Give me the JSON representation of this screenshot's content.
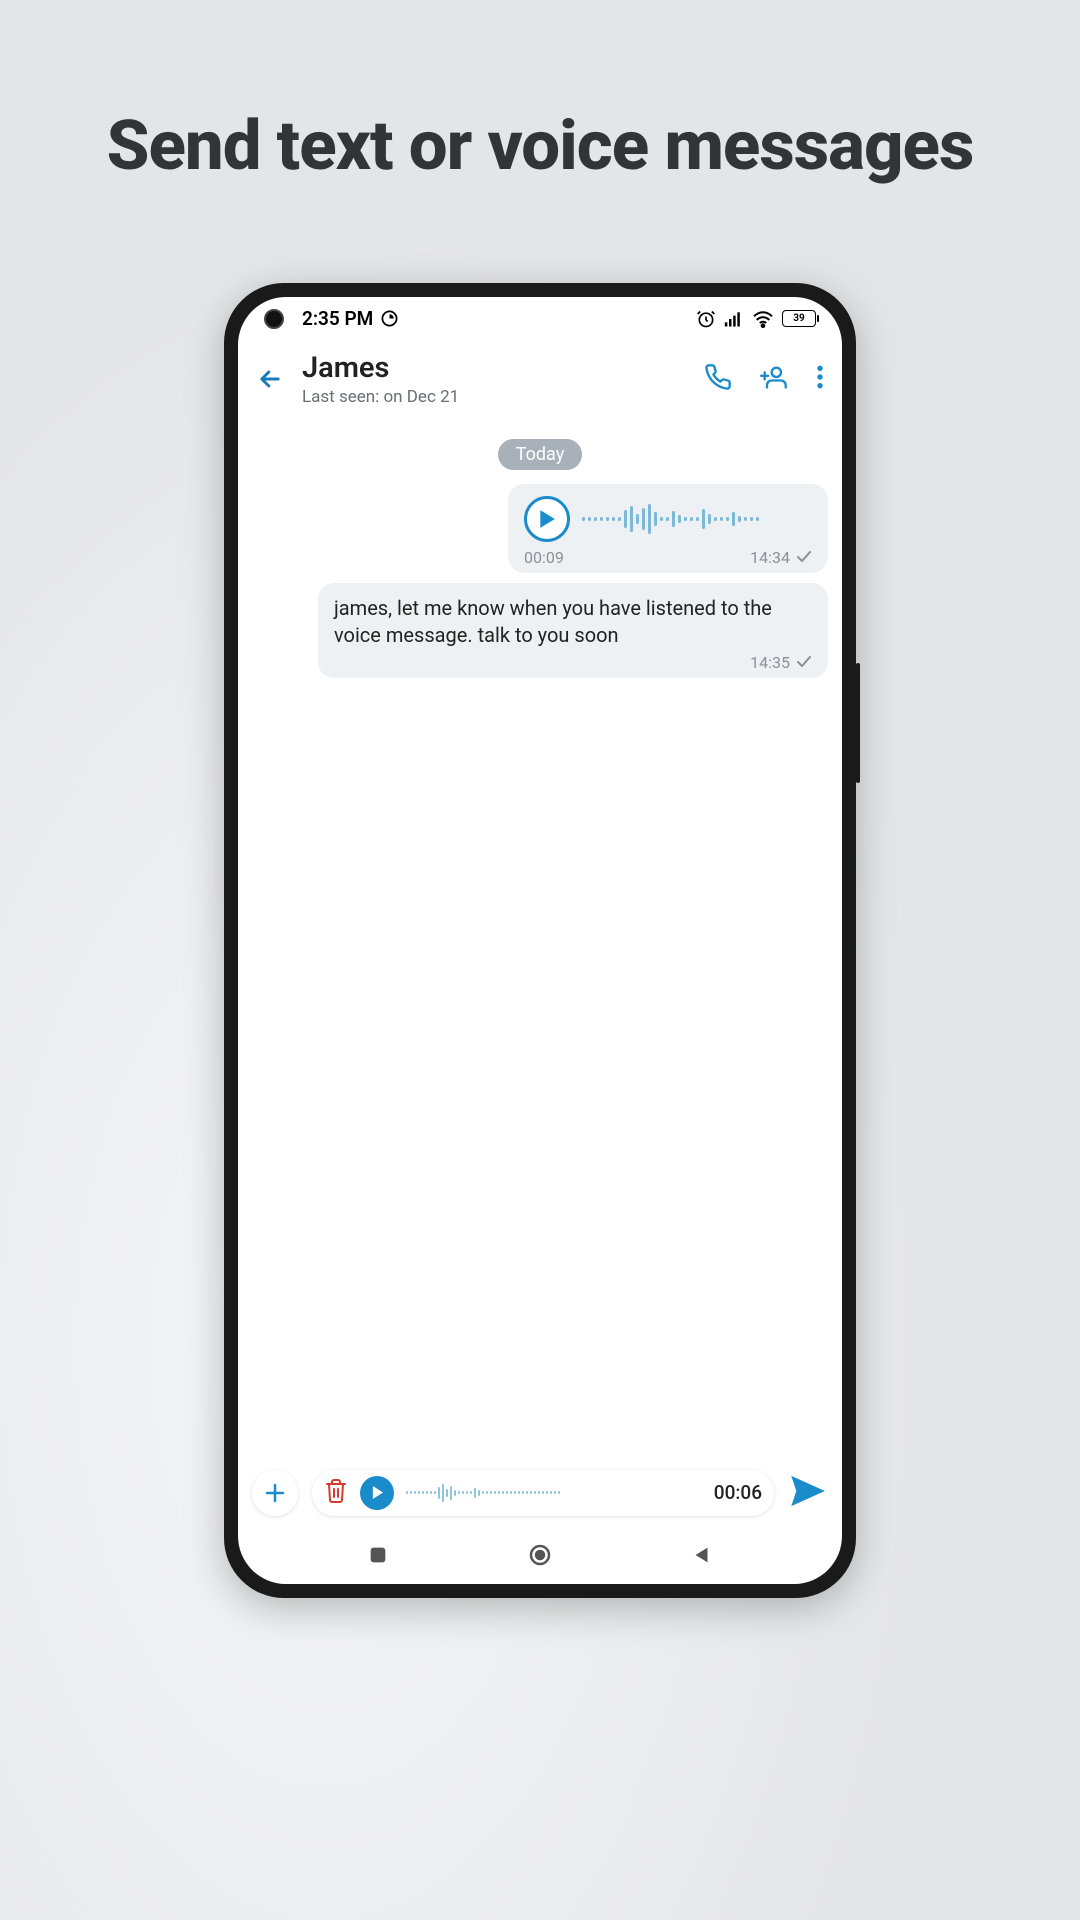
{
  "promo": {
    "headline": "Send text or voice messages"
  },
  "statusBar": {
    "time": "2:35 PM",
    "batteryLevel": "39"
  },
  "header": {
    "contactName": "James",
    "lastSeen": "Last seen: on Dec 21"
  },
  "chat": {
    "dateBadge": "Today",
    "voiceMessage": {
      "duration": "00:09",
      "timestamp": "14:34"
    },
    "textMessage": {
      "text": "james, let me know when you have listened to the voice message. talk to you soon",
      "timestamp": "14:35"
    }
  },
  "composer": {
    "recordingDuration": "00:06"
  }
}
